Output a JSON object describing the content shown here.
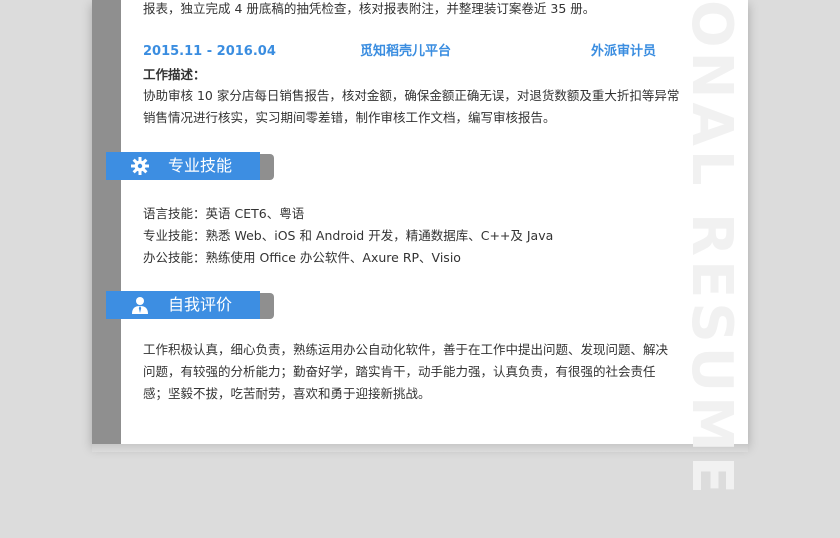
{
  "experience": {
    "top_line": "报表，独立完成 4 册底稿的抽凭检查，核对报表附注，并整理装订案卷近 35 册。",
    "date": "2015.11 - 2016.04",
    "company": "觅知稻壳儿平台",
    "position": "外派审计员",
    "desc_label": "工作描述：",
    "desc_lines": [
      "协助审核 10 家分店每日销售报告，核对金额，确保金额正确无误，对退货数额及重大折扣等异常",
      "销售情况进行核实，实习期间零差错，制作审核工作文档，编写审核报告。"
    ]
  },
  "skills": {
    "title": "专业技能",
    "icon": "gear-icon",
    "lines": [
      "语言技能：英语 CET6、粤语",
      "专业技能：熟悉 Web、iOS 和 Android 开发，精通数据库、C++及 Java",
      "办公技能：熟练使用 Office 办公软件、Axure RP、Visio"
    ]
  },
  "self_eval": {
    "title": "自我评价",
    "icon": "user-icon",
    "lines": [
      "工作积极认真，细心负责，熟练运用办公自动化软件，善于在工作中提出问题、发现问题、解决",
      "问题，有较强的分析能力；勤奋好学，踏实肯干，动手能力强，认真负责，有很强的社会责任",
      "感；坚毅不拔，吃苦耐劳，喜欢和勇于迎接新挑战。"
    ]
  },
  "watermark": "ONAL RESUME",
  "colors": {
    "accent": "#3d8ee2",
    "sidebar": "#8f8f8f"
  }
}
